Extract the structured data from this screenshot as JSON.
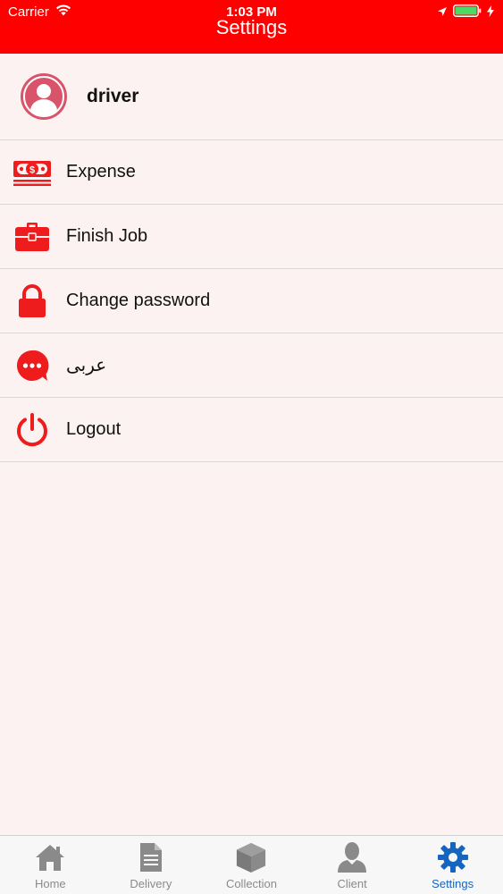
{
  "status_bar": {
    "carrier": "Carrier",
    "time": "1:03 PM"
  },
  "nav": {
    "title": "Settings"
  },
  "profile": {
    "username": "driver"
  },
  "menu": {
    "items": [
      {
        "label": "Expense",
        "icon": "money-icon"
      },
      {
        "label": "Finish Job",
        "icon": "briefcase-icon"
      },
      {
        "label": "Change password",
        "icon": "lock-icon"
      },
      {
        "label": "عربى",
        "icon": "chat-bubble-icon"
      },
      {
        "label": "Logout",
        "icon": "power-icon"
      }
    ]
  },
  "tabs": [
    {
      "label": "Home",
      "icon": "home-icon"
    },
    {
      "label": "Delivery",
      "icon": "document-icon"
    },
    {
      "label": "Collection",
      "icon": "box-icon"
    },
    {
      "label": "Client",
      "icon": "person-icon"
    },
    {
      "label": "Settings",
      "icon": "gear-icon",
      "active": true
    }
  ],
  "colors": {
    "header": "#fe0000",
    "accent_red": "#ee1c1c",
    "background": "#fdf2f2",
    "active_tab": "#1565c0",
    "inactive_tab": "#8a8a8a",
    "avatar": "#d9536a",
    "battery": "#4cd964"
  }
}
